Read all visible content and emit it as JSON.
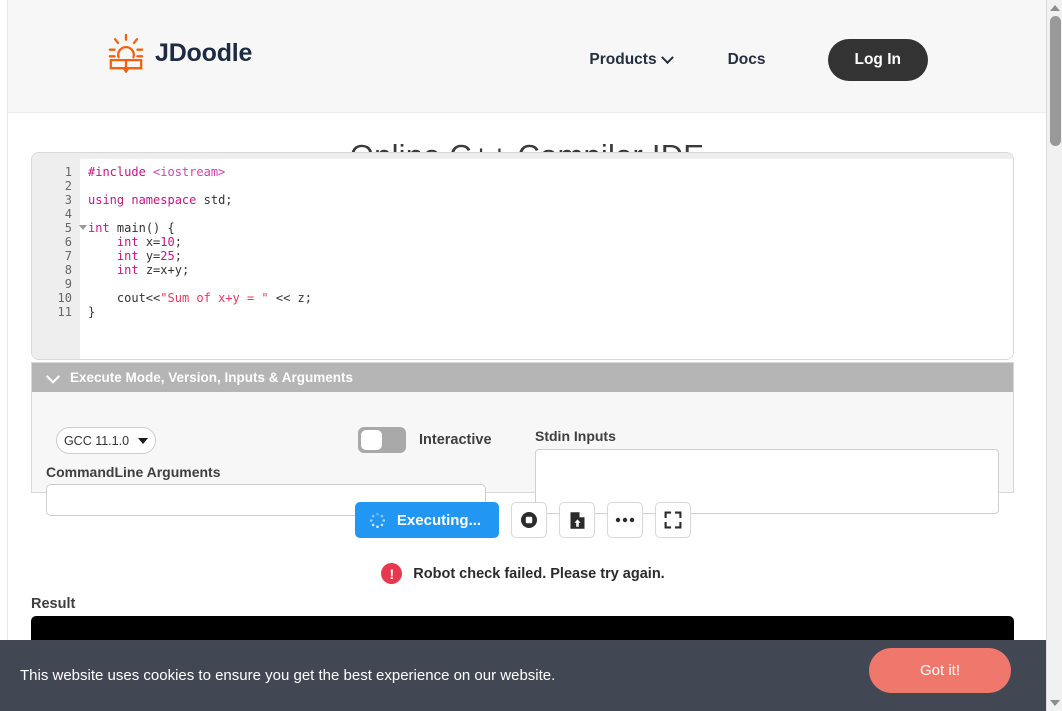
{
  "header": {
    "brand_name": "JDoodle",
    "brand_icon": "sun-book-logo-icon",
    "nav": [
      {
        "label": "Products",
        "icon": "chevron-down-icon"
      },
      {
        "label": "Docs",
        "icon": ""
      }
    ],
    "login_label": "Log In"
  },
  "page": {
    "title": "Online C++ Compiler IDE"
  },
  "editor": {
    "language": "c++",
    "line_numbers": [
      "1",
      "2",
      "3",
      "4",
      "5",
      "6",
      "7",
      "8",
      "9",
      "10",
      "11"
    ],
    "fold_line": "5",
    "lines": [
      {
        "n": "1",
        "text": "#include <iostream>"
      },
      {
        "n": "2",
        "text": ""
      },
      {
        "n": "3",
        "text": "using namespace std;"
      },
      {
        "n": "4",
        "text": ""
      },
      {
        "n": "5",
        "text": "int main() {"
      },
      {
        "n": "6",
        "text": "    int x=10;"
      },
      {
        "n": "7",
        "text": "    int y=25;"
      },
      {
        "n": "8",
        "text": "    int z=x+y;"
      },
      {
        "n": "9",
        "text": ""
      },
      {
        "n": "10",
        "text": "    cout<<\"Sum of x+y = \" << z;"
      },
      {
        "n": "11",
        "text": "}"
      }
    ]
  },
  "settings": {
    "accordion_title": "Execute Mode, Version, Inputs & Arguments",
    "accordion_icon": "chevron-down-icon",
    "version_value": "GCC 11.1.0",
    "version_icon": "chevron-down-icon",
    "interactive_label": "Interactive",
    "interactive_on": false,
    "cmdline_label": "CommandLine Arguments",
    "cmdline_value": "",
    "cmdline_placeholder": "",
    "stdin_label": "Stdin Inputs",
    "stdin_value": "",
    "stdin_placeholder": ""
  },
  "actions": {
    "execute_label": "Executing...",
    "execute_icon": "spinner-icon",
    "execute_color": "#2196f3",
    "stop_icon": "stop-icon",
    "open_file_icon": "file-upload-icon",
    "more_icon": "ellipsis-icon",
    "fullscreen_icon": "fullscreen-icon"
  },
  "status": {
    "error_icon": "error-exclamation-icon",
    "error_text": "Robot check failed. Please try again.",
    "error_color": "#e8384f"
  },
  "result": {
    "label": "Result",
    "console_output": ""
  },
  "cookie": {
    "message": "This website uses cookies to ensure you get the best experience on our website.",
    "button_label": "Got it!",
    "button_color": "#f0776c",
    "banner_color": "#424853"
  },
  "scrollbar": {
    "up_icon": "scroll-up-arrow-icon",
    "down_icon": "scroll-down-arrow-icon"
  }
}
